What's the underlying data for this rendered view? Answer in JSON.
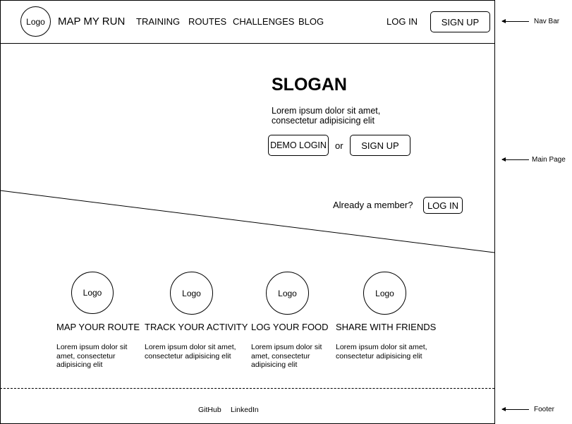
{
  "nav": {
    "logo": "Logo",
    "brand": "MAP MY RUN",
    "links": [
      "TRAINING",
      "ROUTES",
      "CHALLENGES",
      "BLOG"
    ],
    "login": "LOG IN",
    "signup": "SIGN UP"
  },
  "hero": {
    "slogan": "SLOGAN",
    "text_line1": "Lorem ipsum dolor sit amet,",
    "text_line2": "consectetur adipisicing elit",
    "demo_login": "DEMO LOGIN",
    "or": "or",
    "signup": "SIGN UP",
    "member_prompt": "Already a member?",
    "login": "LOG IN"
  },
  "features": [
    {
      "logo": "Logo",
      "title": "MAP YOUR ROUTE",
      "body": "Lorem ipsum dolor sit amet, consectetur adipisicing elit"
    },
    {
      "logo": "Logo",
      "title": "TRACK YOUR ACTIVITY",
      "body": "Lorem ipsum dolor sit amet, consectetur adipisicing elit"
    },
    {
      "logo": "Logo",
      "title": "LOG YOUR FOOD",
      "body": "Lorem ipsum dolor sit amet, consectetur adipisicing elit"
    },
    {
      "logo": "Logo",
      "title": "SHARE WITH FRIENDS",
      "body": "Lorem ipsum dolor sit amet, consectetur adipisicing elit"
    }
  ],
  "footer": {
    "links": [
      "GitHub",
      "LinkedIn"
    ]
  },
  "annotations": {
    "nav_bar": "Nav Bar",
    "main_page": "Main Page",
    "footer": "Footer"
  }
}
